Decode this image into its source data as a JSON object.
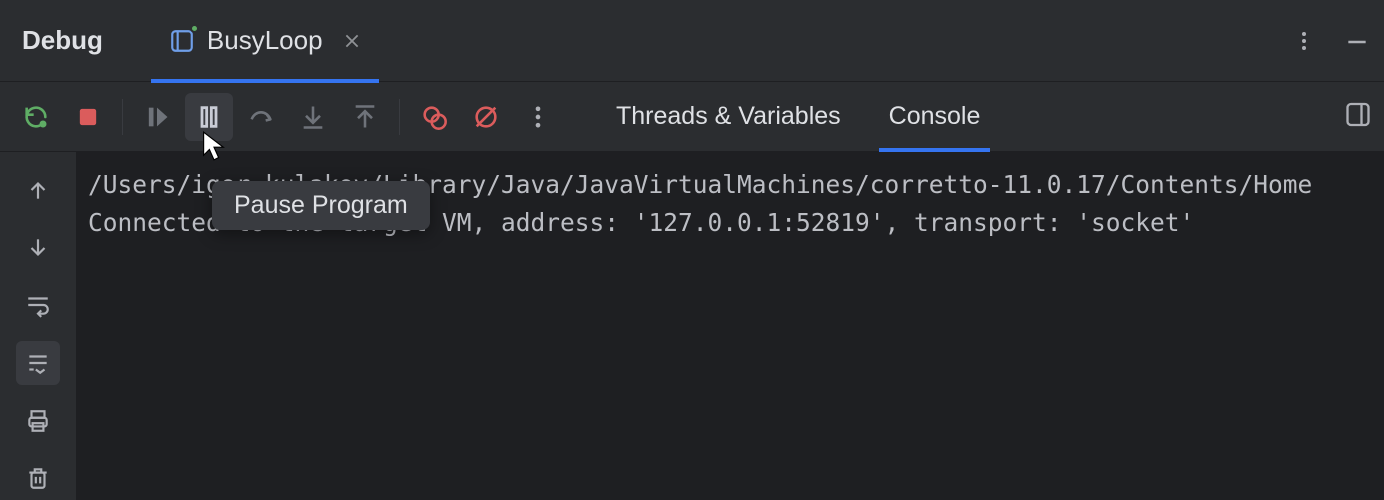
{
  "header": {
    "title": "Debug",
    "run_config": "BusyLoop"
  },
  "toolbar": {
    "tabs": {
      "threads": "Threads & Variables",
      "console": "Console"
    }
  },
  "tooltip": {
    "pause": "Pause Program"
  },
  "console": {
    "line1": "/Users/igor.kulakov/Library/Java/JavaVirtualMachines/corretto-11.0.17/Contents/Home",
    "line2": "Connected to the target VM, address: '127.0.0.1:52819', transport: 'socket'"
  }
}
